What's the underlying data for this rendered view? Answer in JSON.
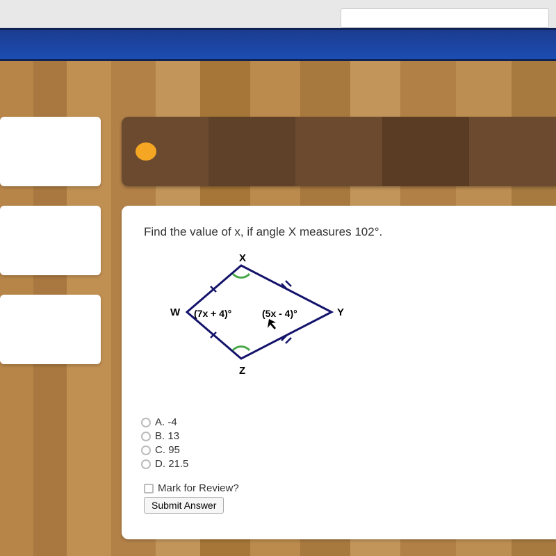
{
  "question": {
    "prompt": "Find the value of x, if angle X measures 102°.",
    "diagram": {
      "vertices": {
        "top": "X",
        "left": "W",
        "right": "Y",
        "bottom": "Z"
      },
      "angle_left_label": "(7x + 4)°",
      "angle_right_label": "(5x - 4)°",
      "given_angle": "102°"
    },
    "options": [
      {
        "letter": "A",
        "value": "-4"
      },
      {
        "letter": "B",
        "value": "13"
      },
      {
        "letter": "C",
        "value": "95"
      },
      {
        "letter": "D",
        "value": "21.5"
      }
    ],
    "mark_label": "Mark for Review?",
    "submit_label": "Submit Answer"
  }
}
